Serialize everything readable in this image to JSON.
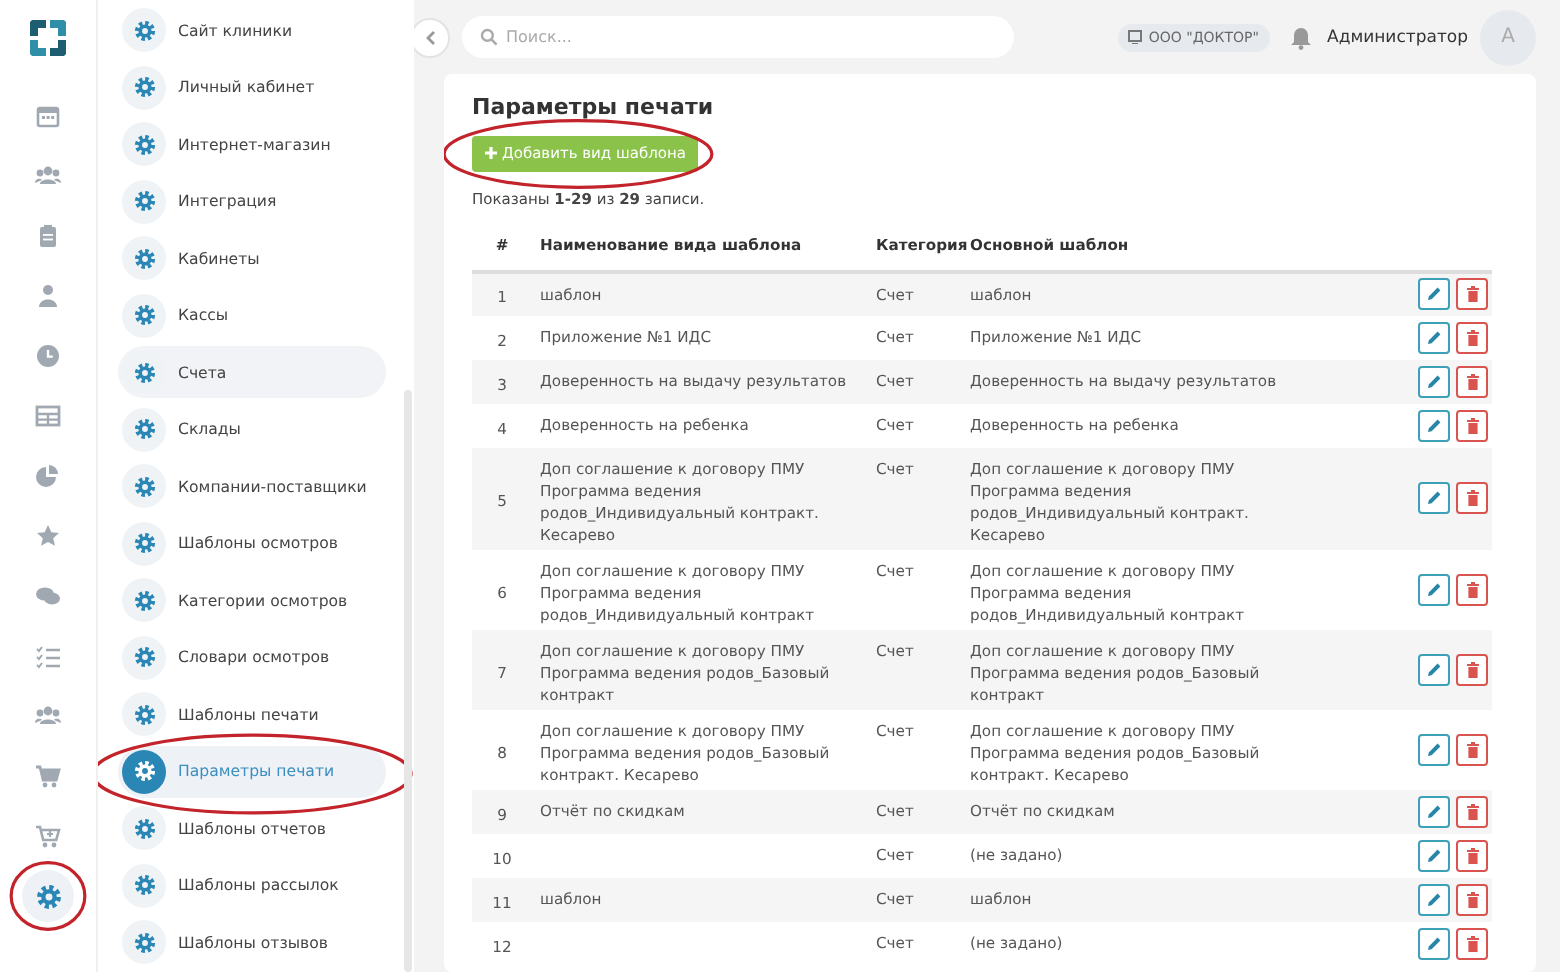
{
  "rail": {
    "items": [
      {
        "selected": false,
        "highlighted": false
      },
      {
        "selected": false,
        "highlighted": false
      },
      {
        "selected": false,
        "highlighted": false
      },
      {
        "selected": false,
        "highlighted": false
      },
      {
        "selected": false,
        "highlighted": false
      },
      {
        "selected": false,
        "highlighted": false
      },
      {
        "selected": false,
        "highlighted": false
      },
      {
        "selected": false,
        "highlighted": false
      },
      {
        "selected": false,
        "highlighted": false
      },
      {
        "selected": false,
        "highlighted": false
      },
      {
        "selected": false,
        "highlighted": false
      },
      {
        "selected": false,
        "highlighted": false
      },
      {
        "selected": false,
        "highlighted": false
      },
      {
        "selected": true,
        "highlighted": true
      }
    ]
  },
  "sidebar": {
    "items": [
      {
        "label": "Сайт клиники",
        "selected": false,
        "hovered": false,
        "highlighted": false
      },
      {
        "label": "Личный кабинет",
        "selected": false,
        "hovered": false,
        "highlighted": false
      },
      {
        "label": "Интернет-магазин",
        "selected": false,
        "hovered": false,
        "highlighted": false
      },
      {
        "label": "Интеграция",
        "selected": false,
        "hovered": false,
        "highlighted": false
      },
      {
        "label": "Кабинеты",
        "selected": false,
        "hovered": false,
        "highlighted": false
      },
      {
        "label": "Кассы",
        "selected": false,
        "hovered": false,
        "highlighted": false
      },
      {
        "label": "Счета",
        "selected": false,
        "hovered": true,
        "highlighted": false
      },
      {
        "label": "Склады",
        "selected": false,
        "hovered": false,
        "highlighted": false
      },
      {
        "label": "Компании-поставщики",
        "selected": false,
        "hovered": false,
        "highlighted": false
      },
      {
        "label": "Шаблоны осмотров",
        "selected": false,
        "hovered": false,
        "highlighted": false
      },
      {
        "label": "Категории осмотров",
        "selected": false,
        "hovered": false,
        "highlighted": false
      },
      {
        "label": "Словари осмотров",
        "selected": false,
        "hovered": false,
        "highlighted": false
      },
      {
        "label": "Шаблоны печати",
        "selected": false,
        "hovered": false,
        "highlighted": false
      },
      {
        "label": "Параметры печати",
        "selected": true,
        "hovered": false,
        "highlighted": true
      },
      {
        "label": "Шаблоны отчетов",
        "selected": false,
        "hovered": false,
        "highlighted": false
      },
      {
        "label": "Шаблоны рассылок",
        "selected": false,
        "hovered": false,
        "highlighted": false
      },
      {
        "label": "Шаблоны отзывов",
        "selected": false,
        "hovered": false,
        "highlighted": false
      }
    ]
  },
  "topbar": {
    "search": {
      "placeholder": "Поиск..."
    },
    "organization": "ООО \"ДОКТОР\"",
    "user": "Администратор",
    "avatar": "А"
  },
  "page": {
    "title": "Параметры печати",
    "add_button": {
      "label": "Добавить вид шаблона",
      "highlighted": true
    },
    "summary": "Показаны **1-29** из **29** записи.",
    "table": {
      "columns": [
        "#",
        "Наименование вида шаблона",
        "Категория",
        "Основной шаблон"
      ],
      "rows": [
        [
          "1",
          "шаблон",
          "Счет",
          "шаблон"
        ],
        [
          "2",
          "Приложение №1 ИДС",
          "Счет",
          "Приложение №1 ИДС"
        ],
        [
          "3",
          "Доверенность на выдачу результатов",
          "Счет",
          "Доверенность на выдачу результатов"
        ],
        [
          "4",
          "Доверенность на ребенка",
          "Счет",
          "Доверенность на ребенка"
        ],
        [
          "5",
          "Доп соглашение к договору ПМУ Программа ведения родов_Индивидуальный контракт. Кесарево",
          "Счет",
          "Доп соглашение к договору ПМУ Программа ведения родов_Индивидуальный контракт. Кесарево"
        ],
        [
          "6",
          "Доп соглашение к договору ПМУ Программа ведения родов_Индивидуальный контракт",
          "Счет",
          "Доп соглашение к договору ПМУ Программа ведения родов_Индивидуальный контракт"
        ],
        [
          "7",
          "Доп соглашение к договору ПМУ Программа ведения родов_Базовый контракт",
          "Счет",
          "Доп соглашение к договору ПМУ Программа ведения родов_Базовый контракт"
        ],
        [
          "8",
          "Доп соглашение к договору ПМУ Программа ведения родов_Базовый контракт. Кесарево",
          "Счет",
          "Доп соглашение к договору ПМУ Программа ведения родов_Базовый контракт. Кесарево"
        ],
        [
          "9",
          "Отчёт по скидкам",
          "Счет",
          "Отчёт по скидкам"
        ],
        [
          "10",
          "",
          "Счет",
          "(не задано)"
        ],
        [
          "11",
          "шаблон",
          "Счет",
          "шаблон"
        ],
        [
          "12",
          "",
          "Счет",
          "(не задано)"
        ]
      ]
    }
  }
}
